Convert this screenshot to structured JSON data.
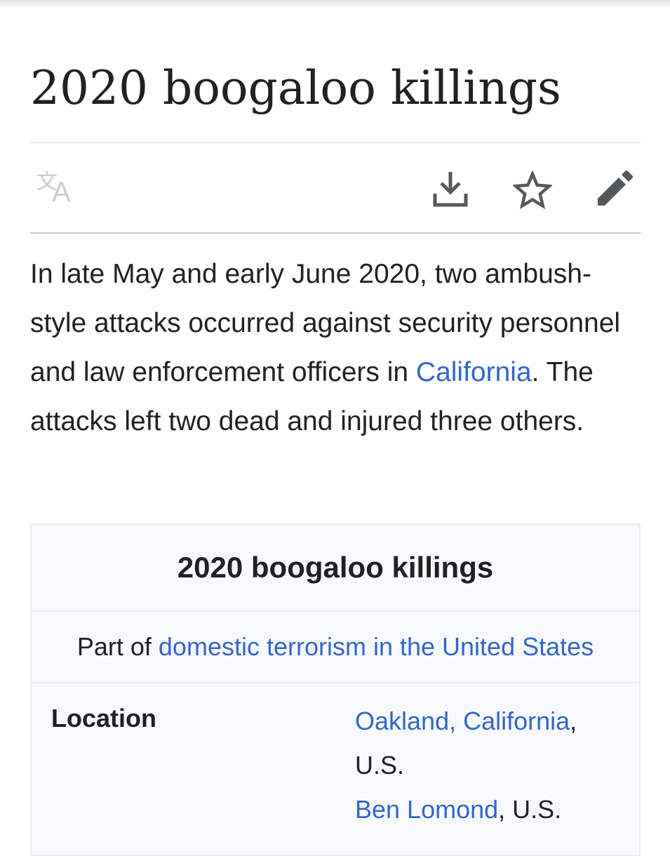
{
  "article": {
    "title": "2020 boogaloo killings",
    "lead": {
      "part1": "In late May and early June 2020, two ambush-style attacks occurred against security personnel and law enforcement officers in ",
      "link_california": "California",
      "part2": ". The attacks left two dead and injured three others."
    }
  },
  "toolbar": {
    "language_icon": "translate-icon",
    "download_icon": "download-icon",
    "watch_icon": "star-icon",
    "edit_icon": "pencil-icon",
    "language_glyph_1": "文",
    "language_glyph_2": "A"
  },
  "infobox": {
    "title": "2020 boogaloo killings",
    "part_of_label": "Part of",
    "part_of_link": "domestic terrorism in the United States",
    "location_label": "Location",
    "location": {
      "link_oakland": "Oakland, California",
      "sep1": ",",
      "us1": "U.S.",
      "link_ben_lomond": "Ben Lomond",
      "us2": ", U.S."
    }
  },
  "colors": {
    "link": "#3366cc",
    "text": "#202122",
    "icon": "#54595d",
    "icon_disabled": "#c8ccd1",
    "infobox_bg": "#f8f9fa",
    "border": "#eaecf0"
  }
}
